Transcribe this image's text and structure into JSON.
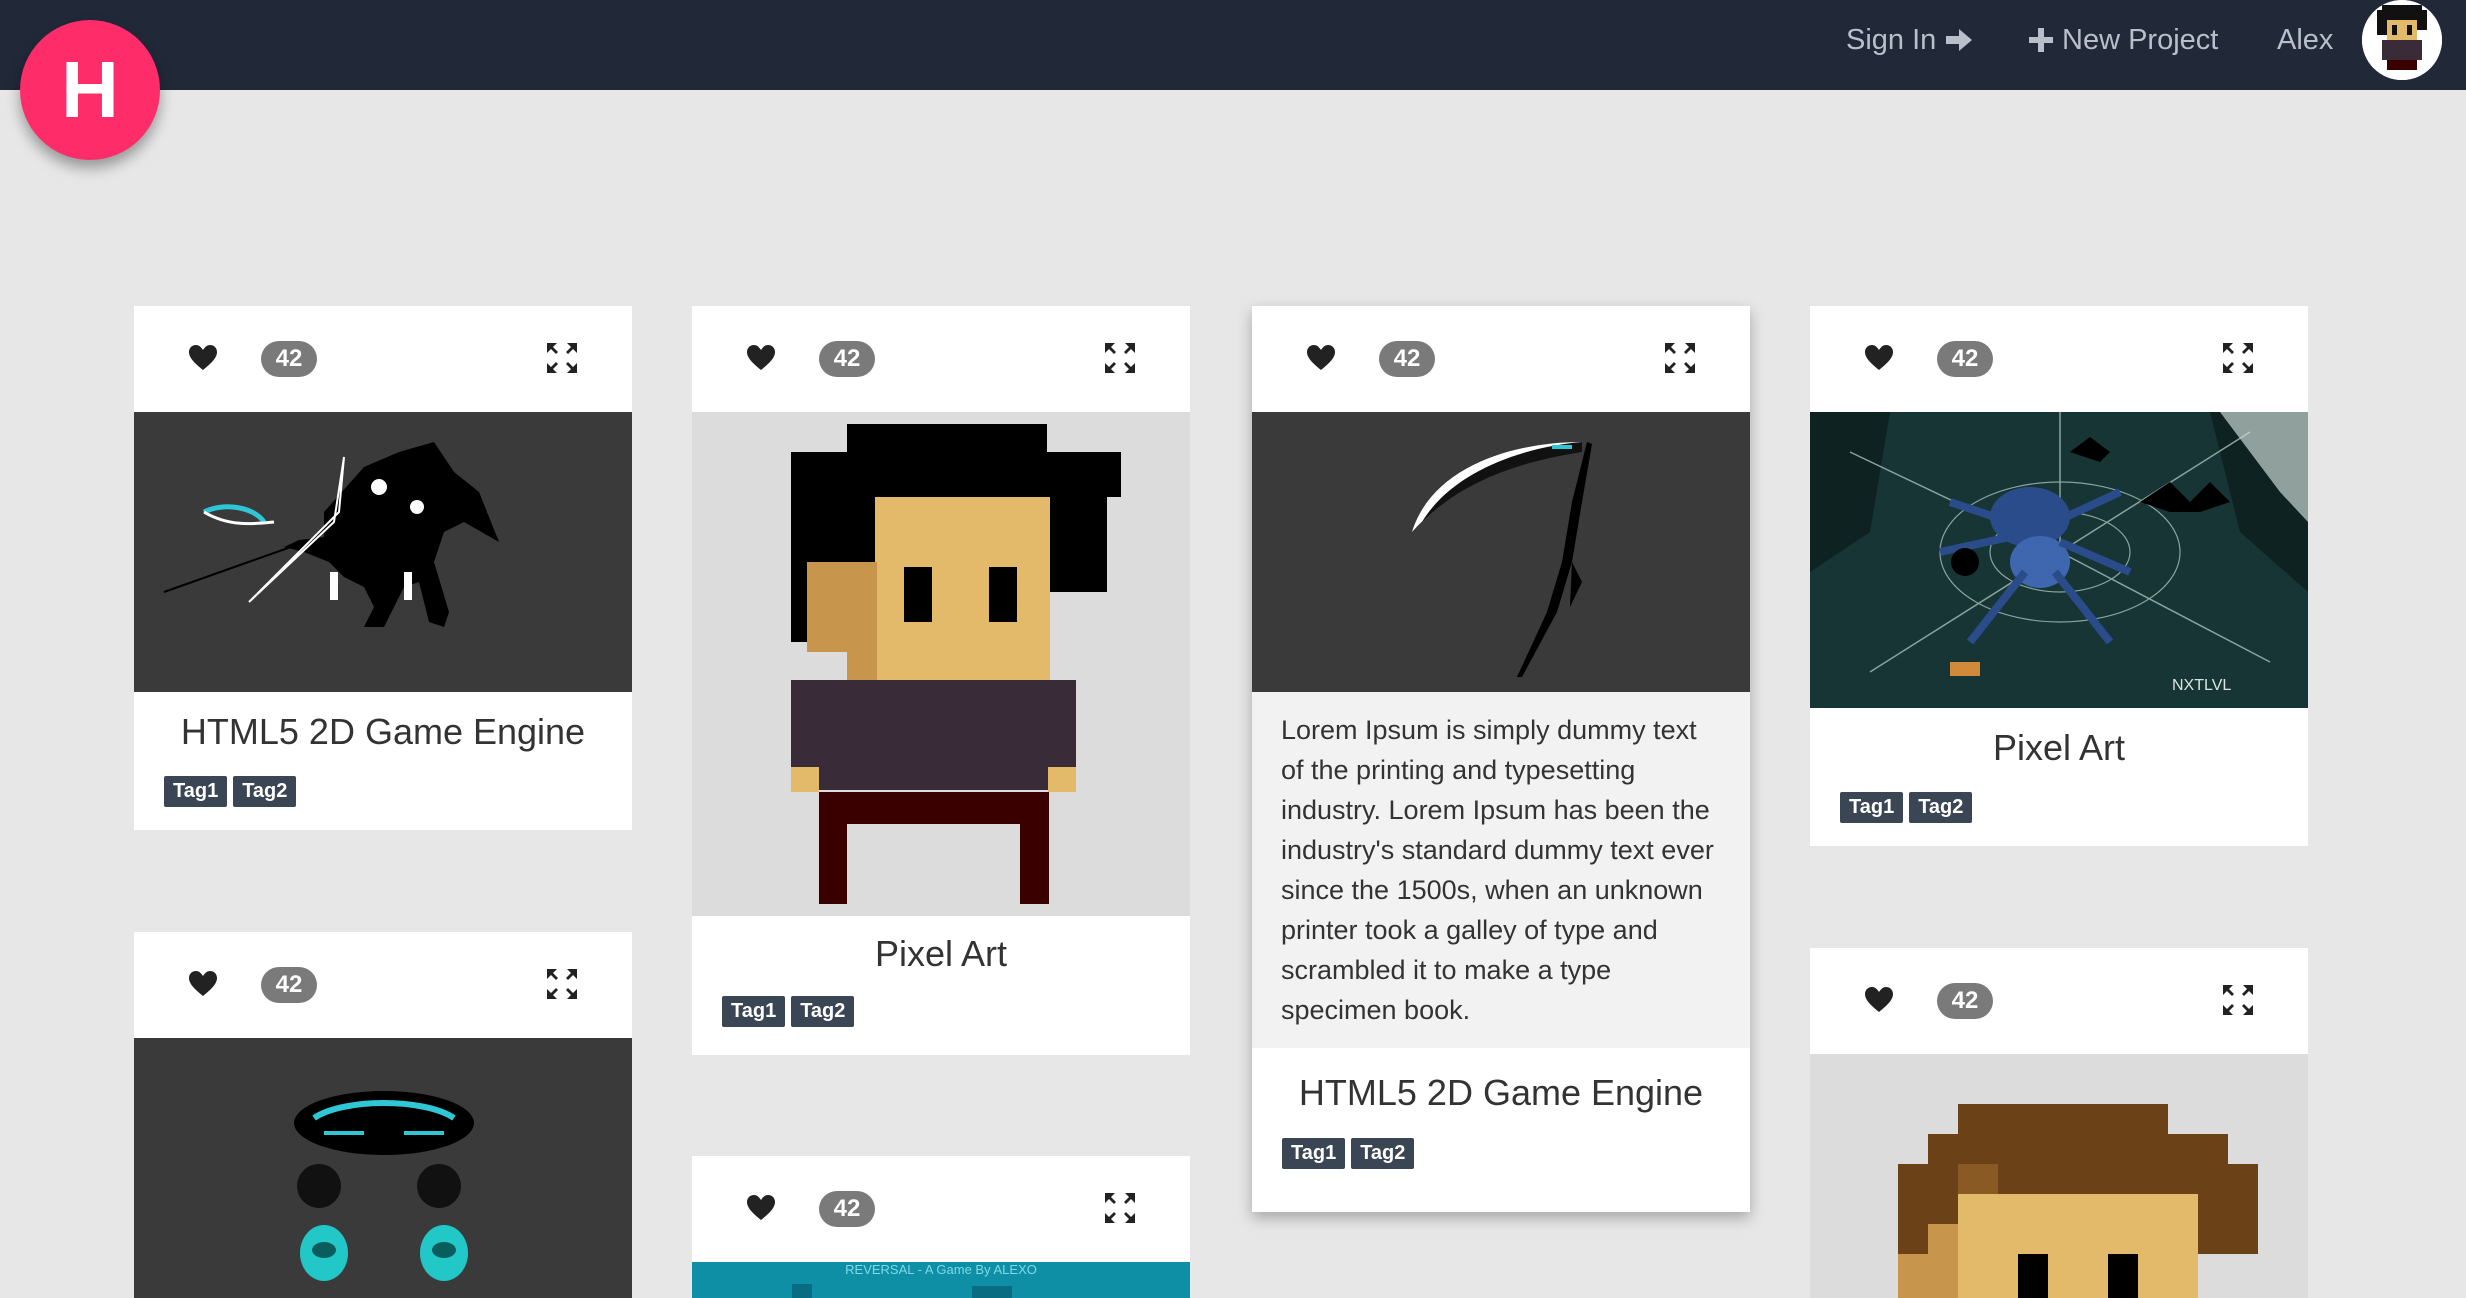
{
  "nav": {
    "sign_in": "Sign In",
    "new_project": "New Project",
    "user_name": "Alex"
  },
  "logo": {
    "letter": "H",
    "color": "#fe2d6a"
  },
  "cards": [
    {
      "count": "42",
      "title": "HTML5 2D Game Engine",
      "tags": [
        "Tag1",
        "Tag2"
      ]
    },
    {
      "count": "42",
      "title": "Pixel Art",
      "tags": [
        "Tag1",
        "Tag2"
      ]
    },
    {
      "count": "42",
      "description": "Lorem Ipsum is simply dummy text of the printing and typesetting industry. Lorem Ipsum has been the industry's standard dummy text ever since the 1500s, when an unknown printer took a galley of type and scrambled it to make a type specimen book.",
      "title": "HTML5 2D Game Engine",
      "tags": [
        "Tag1",
        "Tag2"
      ]
    },
    {
      "count": "42",
      "title": "Pixel Art",
      "tags": [
        "Tag1",
        "Tag2"
      ],
      "watermark": "NXTLVL"
    },
    {
      "count": "42"
    },
    {
      "count": "42",
      "banner_text": "REVERSAL - A Game By ALEXO"
    },
    {
      "count": "42"
    }
  ],
  "icons": {
    "like": "heart-icon",
    "expand": "expand-icon",
    "sign_in": "sign-in-arrow-icon",
    "new_project": "plus-icon"
  },
  "colors": {
    "navbar": "#212838",
    "background": "#e7e7e7",
    "accent": "#fe2d6a",
    "tag": "#3b4654",
    "count_badge": "#7a7a7a"
  }
}
